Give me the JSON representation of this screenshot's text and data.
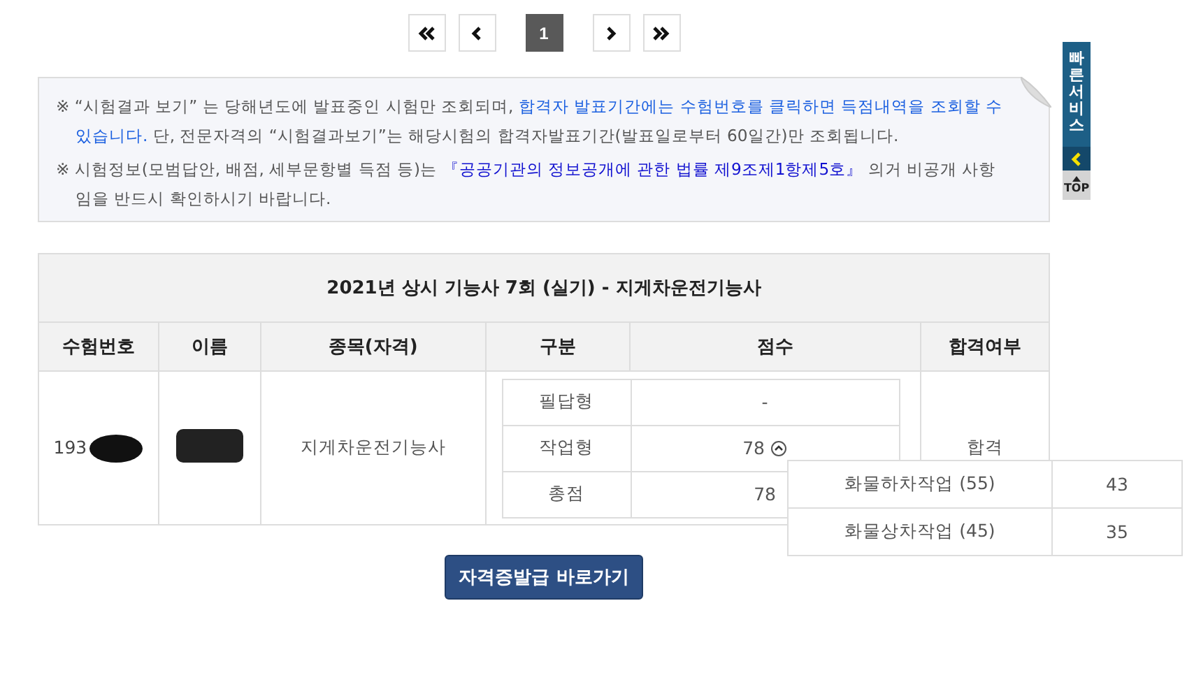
{
  "pagination": [
    {
      "kind": "first"
    },
    {
      "kind": "prev"
    },
    {
      "kind": "page",
      "label": "1",
      "selected": true
    },
    {
      "kind": "next"
    },
    {
      "kind": "last"
    }
  ],
  "notices": [
    {
      "segments": [
        {
          "kind": "plain",
          "text": "※ “시험결과 보기” 는 당해년도에 발표중인 시험만 조회되며, "
        },
        {
          "kind": "blue",
          "text": "합격자 발표기간에는 수험번호를 클릭하면 득점내역을 조회할 수 있습니다."
        },
        {
          "kind": "plain",
          "text": " 단, 전문자격의 “시험결과보기”는 해당시험의 합격자발표기간(발표일로부터 60일간)만 조회됩니다."
        }
      ]
    },
    {
      "segments": [
        {
          "kind": "plain",
          "text": "※ 시험정보(모범답안, 배점, 세부문항별 득점 등)는 "
        },
        {
          "kind": "law",
          "text": "『공공기관의 정보공개에 관한 법률 제9조제1항제5호』"
        },
        {
          "kind": "plain",
          "text": " 의거 비공개 사항임을 반드시 확인하시기 바랍니다."
        }
      ]
    }
  ],
  "quick_service": {
    "title": "빠른서비스",
    "top_label": "TOP"
  },
  "result_table": {
    "title": "2021년 상시 기능사 7회 (실기) - 지게차운전기능사",
    "columns": [
      "수험번호",
      "이름",
      "종목(자격)",
      "구분",
      "점수",
      "합격여부"
    ],
    "row": {
      "exam_number": "193",
      "qualification": "지게차운전기능사",
      "result": "합격",
      "scores": [
        {
          "kind": "plain",
          "type": "필답형",
          "score": "-"
        },
        {
          "kind": "detail",
          "type": "작업형",
          "score": "78",
          "expanded": true
        },
        {
          "kind": "plain",
          "type": "총점",
          "score": "78"
        }
      ]
    },
    "breakdown": [
      {
        "item": "화물하차작업 (55)",
        "score": "43"
      },
      {
        "item": "화물상차작업 (45)",
        "score": "35"
      }
    ]
  },
  "certificate_button": "자격증발급 바로가기"
}
